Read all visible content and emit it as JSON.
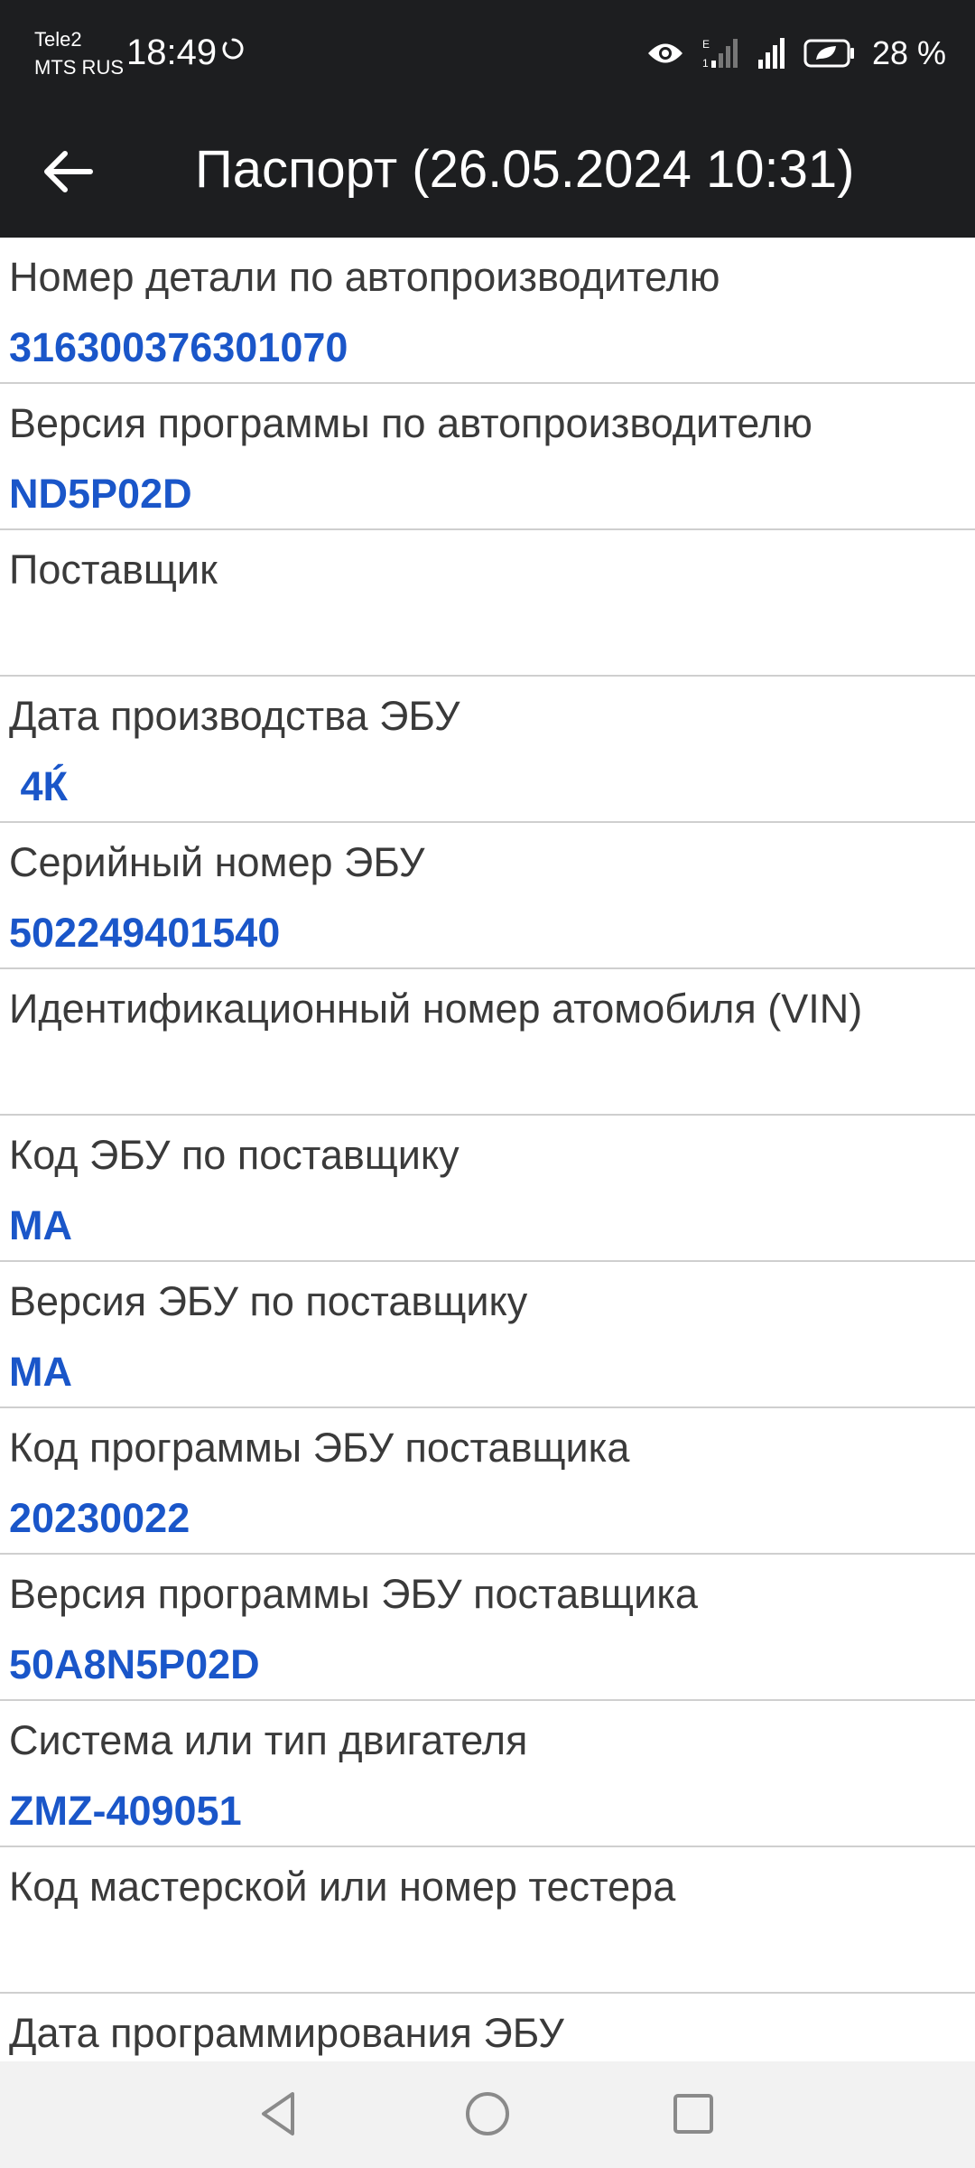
{
  "status_bar": {
    "carrier_1": "Tele2",
    "carrier_2": "MTS RUS",
    "time": "18:49",
    "battery_percent": "28 %",
    "icons": [
      "sync-icon",
      "eye-icon",
      "signal-edge-icon",
      "signal-icon",
      "battery-saver-icon"
    ]
  },
  "app_bar": {
    "title": "Паспорт (26.05.2024 10:31)",
    "back_icon": "arrow-left-icon"
  },
  "items": [
    {
      "label": "Номер детали по автопроизводителю",
      "value": "316300376301070"
    },
    {
      "label": "Версия программы по автопроизводителю",
      "value": "ND5P02D"
    },
    {
      "label": "Поставщик",
      "value": ""
    },
    {
      "label": "Дата производства ЭБУ",
      "value": " 4Ќ"
    },
    {
      "label": "Серийный номер ЭБУ",
      "value": "502249401540"
    },
    {
      "label": "Идентификационный номер атомобиля (VIN)",
      "value": ""
    },
    {
      "label": "Код ЭБУ по поставщику",
      "value": "MA"
    },
    {
      "label": "Версия ЭБУ по поставщику",
      "value": "MA"
    },
    {
      "label": "Код программы ЭБУ поставщика",
      "value": "20230022"
    },
    {
      "label": "Версия программы ЭБУ поставщика",
      "value": "50A8N5P02D"
    },
    {
      "label": "Система или тип двигателя",
      "value": "ZMZ-409051"
    },
    {
      "label": "Код мастерской или номер тестера",
      "value": ""
    },
    {
      "label": "Дата программирования ЭБУ",
      "value": ""
    }
  ],
  "nav_bar": {
    "icons": [
      "nav-back-icon",
      "nav-home-icon",
      "nav-recents-icon"
    ]
  },
  "colors": {
    "bar_background": "#1d1e20",
    "value_text": "#1a56c9",
    "label_text": "#3a3a3a",
    "divider": "#cfcfcf",
    "nav_background": "#f2f2f2"
  }
}
